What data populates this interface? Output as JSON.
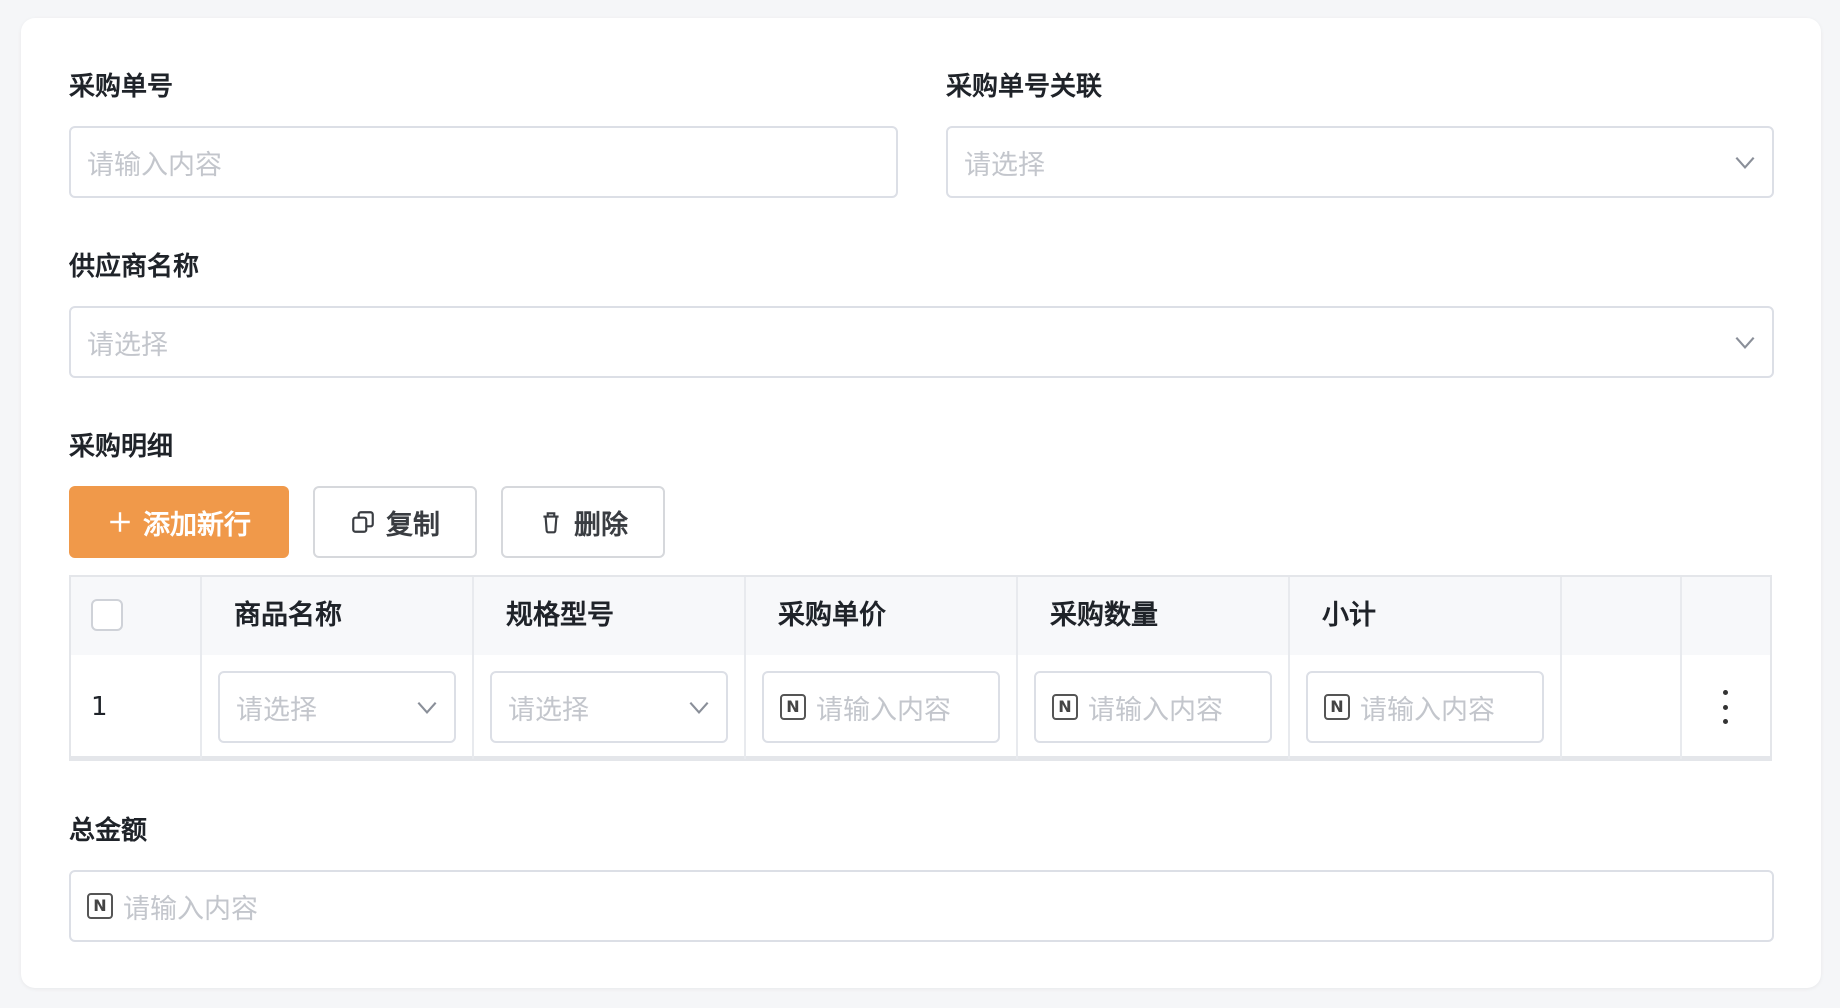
{
  "form": {
    "order_no": {
      "label": "采购单号",
      "placeholder": "请输入内容"
    },
    "order_link": {
      "label": "采购单号关联",
      "placeholder": "请选择"
    },
    "supplier": {
      "label": "供应商名称",
      "placeholder": "请选择"
    },
    "details": {
      "label": "采购明细",
      "buttons": {
        "add": "添加新行",
        "copy": "复制",
        "delete": "删除"
      },
      "columns": [
        "商品名称",
        "规格型号",
        "采购单价",
        "采购数量",
        "小计"
      ],
      "rows": [
        {
          "index": "1",
          "product": "请选择",
          "spec": "请选择",
          "price": "请输入内容",
          "quantity": "请输入内容",
          "subtotal": "请输入内容"
        }
      ],
      "number_icon_glyph": "N"
    },
    "total": {
      "label": "总金额",
      "placeholder": "请输入内容"
    }
  },
  "icons": {
    "chevron": "chevron-down-icon",
    "number": "number-icon",
    "plus": "plus-icon",
    "copy": "copy-icon",
    "trash": "trash-icon",
    "more": "more-vertical-icon"
  },
  "colors": {
    "primary": "#f0994a",
    "placeholder": "#c3c6cc",
    "border": "#dcdfe6"
  }
}
